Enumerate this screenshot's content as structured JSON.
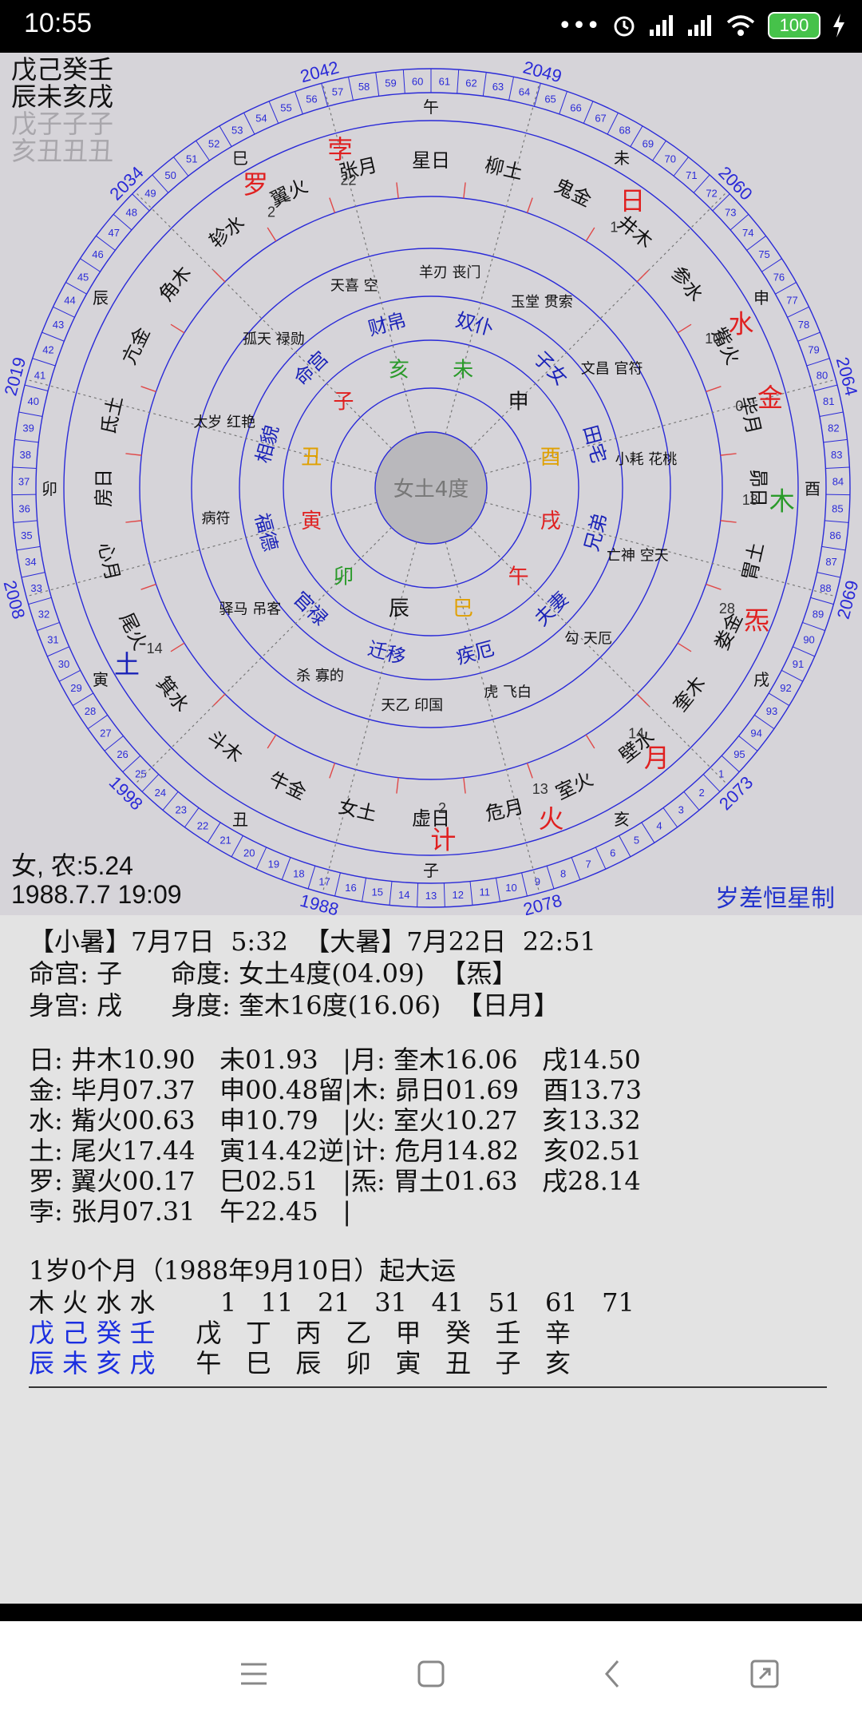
{
  "status": {
    "time": "10:55",
    "battery": "100"
  },
  "chart": {
    "center_label": "女土4度",
    "pillars_dark": [
      "戊己癸壬",
      "辰未亥戌"
    ],
    "pillars_dim": [
      "戊子子子",
      "亥丑丑丑"
    ],
    "gender_line": "女, 农:5.24",
    "datetime_line": "1988.7.7 19:09",
    "brand": "岁差恒星制",
    "branch_ring": [
      "午",
      "未",
      "申",
      "酉",
      "戌",
      "亥",
      "子",
      "丑",
      "寅",
      "卯",
      "辰",
      "巳"
    ],
    "year_labels": [
      "2049",
      "2060",
      "2064",
      "2069",
      "2073",
      "2078",
      "1988",
      "1998",
      "2008",
      "2019",
      "2034",
      "2042"
    ],
    "year_ticks": [
      "61",
      "62",
      "63",
      "64",
      "65",
      "66",
      "67",
      "68",
      "69",
      "70",
      "71",
      "72",
      "73",
      "74",
      "75",
      "76",
      "77",
      "78",
      "79",
      "80",
      "81",
      "82",
      "83",
      "84",
      "85",
      "86",
      "87",
      "88",
      "89",
      "90",
      "91",
      "92",
      "93",
      "94",
      "95",
      "1",
      "2",
      "3",
      "4",
      "5",
      "6",
      "7",
      "8",
      "9",
      "10",
      "11",
      "12",
      "13",
      "14",
      "15",
      "16",
      "17",
      "18",
      "19",
      "20",
      "21",
      "22",
      "23",
      "24",
      "25",
      "26",
      "27",
      "28",
      "29",
      "30",
      "31",
      "32",
      "33",
      "34",
      "35",
      "36",
      "37",
      "38",
      "39",
      "40",
      "41",
      "42",
      "43",
      "44",
      "45",
      "46",
      "47",
      "48",
      "49",
      "50",
      "51",
      "52",
      "53",
      "54",
      "55",
      "56",
      "57",
      "58",
      "59",
      "60"
    ],
    "mansions": [
      "星日",
      "柳土",
      "鬼金",
      "井木",
      "参水",
      "觜火",
      "毕月",
      "昴日",
      "胃土",
      "娄金",
      "奎木",
      "壁水",
      "室火",
      "危月",
      "虚日",
      "女土",
      "牛金",
      "斗木",
      "箕水",
      "尾火",
      "心月",
      "房日",
      "氐土",
      "亢金",
      "角木",
      "轸水",
      "翼火",
      "张月"
    ],
    "palaces": [
      "奴仆",
      "子女",
      "田宅",
      "兄弟",
      "夫妻",
      "疾厄",
      "迁移",
      "官禄",
      "福德",
      "相貌",
      "命宫",
      "财帛"
    ],
    "inner_branches": [
      "未",
      "申",
      "酉",
      "戌",
      "午",
      "巳",
      "辰",
      "卯",
      "寅",
      "丑",
      "子",
      "亥"
    ],
    "stars_ring": [
      "羊刃 丧门",
      "玉堂 贯索",
      "文昌 官符",
      "小耗 花桃",
      "亡神 空天",
      "勾 天厄",
      "虎 飞白",
      "天乙 印国",
      "杀 寡的",
      "驿马 吊客",
      "病符",
      "太岁 红艳",
      "孤天 禄勋",
      "天喜 空"
    ],
    "planets": [
      "日",
      "水",
      "金",
      "木",
      "炁",
      "月",
      "火",
      "计",
      "土",
      "罗",
      "孛"
    ],
    "planet_degrees": [
      "1",
      "10",
      "0",
      "13",
      "28",
      "14",
      "13",
      "2",
      "14",
      "2",
      "22"
    ]
  },
  "text": {
    "line1": "【小暑】7月7日  5:32  【大暑】7月22日  22:51",
    "line2": "命宫: 子      命度: 女土4度(04.09)  【炁】",
    "line3": "身宫: 戌      身度: 奎木16度(16.06)  【日月】",
    "rows": [
      "日: 井木10.90   未01.93   |月: 奎木16.06   戌14.50",
      "金: 毕月07.37   申00.48留|木: 昴日01.69   酉13.73",
      "水: 觜火00.63   申10.79   |火: 室火10.27   亥13.32",
      "土: 尾火17.44   寅14.42逆|计: 危月14.82   亥02.51",
      "罗: 翼火00.17   巳02.51   |炁: 胃土01.63   戌28.14",
      "孛: 张月07.31   午22.45   |"
    ],
    "dayun_title": "1岁0个月（1988年9月10日）起大运",
    "dayun_elements": "木 火 水 水        1   11   21   31   41   51   61   71",
    "dayun_stems_left": "戊 己 癸 壬",
    "dayun_stems_right": "     戊   丁   丙   乙   甲   癸   壬   辛",
    "dayun_branches_left": "辰 未 亥 戌",
    "dayun_branches_right": "     午   巳   辰   卯   寅   丑   子   亥"
  },
  "nav": {
    "menu": "menu-icon",
    "home": "home-icon",
    "back": "back-icon",
    "recent": "recent-icon"
  }
}
